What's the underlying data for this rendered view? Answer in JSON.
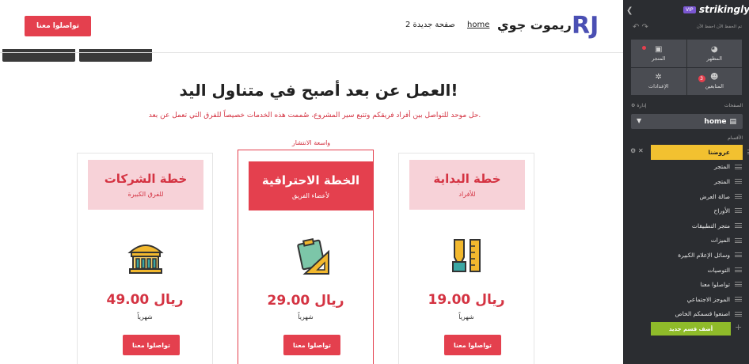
{
  "header": {
    "cta_label": "تواصلوا معنا",
    "nav_home": "home",
    "nav_new_page": "صفحة جديدة 2",
    "brand_name": "ريموت جوي",
    "logo_text": "RJ"
  },
  "hero": {
    "title": "العمل عن بعد أصبح في متناول اليد!",
    "subtitle": "حل موحد للتواصل بين أفراد فريقكم وتتبع سير المشروع، صُممت هذه الخدمات خصيصاً للفرق التي تعمل عن بعد."
  },
  "popular_label": "واسعة الانتشار",
  "plans": [
    {
      "name": "خطة الشركات",
      "for": "للفرق الكبيرة",
      "price": "49.00 ريال",
      "period": "شهرياً",
      "button": "تواصلوا معنا",
      "icon": "building-icon"
    },
    {
      "name": "الخطة الاحترافية",
      "for": "لأعضاء الفريق",
      "price": "29.00 ريال",
      "period": "شهرياً",
      "button": "تواصلوا معنا",
      "icon": "clipboard-ruler-icon"
    },
    {
      "name": "خطة البداية",
      "for": "للأفراد",
      "price": "19.00 ريال",
      "period": "شهرياً",
      "button": "تواصلوا معنا",
      "icon": "pen-ruler-icon"
    }
  ],
  "sidebar": {
    "brand": "strikingly",
    "vip": "VIP",
    "save_note": "تم الحفظ الآن  احفظ الآن",
    "tiles": [
      {
        "label": "المتجر",
        "icon": "store-icon"
      },
      {
        "label": "المظهر",
        "icon": "palette-icon"
      },
      {
        "label": "الإعدادات",
        "icon": "gear-icon"
      },
      {
        "label": "المتابعين",
        "icon": "users-icon",
        "badge": "3"
      }
    ],
    "pages_label": "الصفحات",
    "manage_label": "إدارة",
    "current_page": "home",
    "sections_label": "الأقسام",
    "sections": [
      "عروضنا",
      "المتجر",
      "المتجر",
      "صالة العرض",
      "الأوراح",
      "متجر التطبيقات",
      "الميزات",
      "وسائل الإعلام الكبيرة",
      "التوصيات",
      "تواصلوا معنا",
      "الموجز الاجتماعي",
      "اصنعوا قسمكم الخاص"
    ],
    "add_section": "أضف قسم جديد"
  },
  "colors": {
    "accent": "#e4404e",
    "accent_light": "#f7d2d8",
    "sidebar_bg": "#2b2d31",
    "active_section": "#f2c130",
    "add_button": "#8fbb2a"
  }
}
